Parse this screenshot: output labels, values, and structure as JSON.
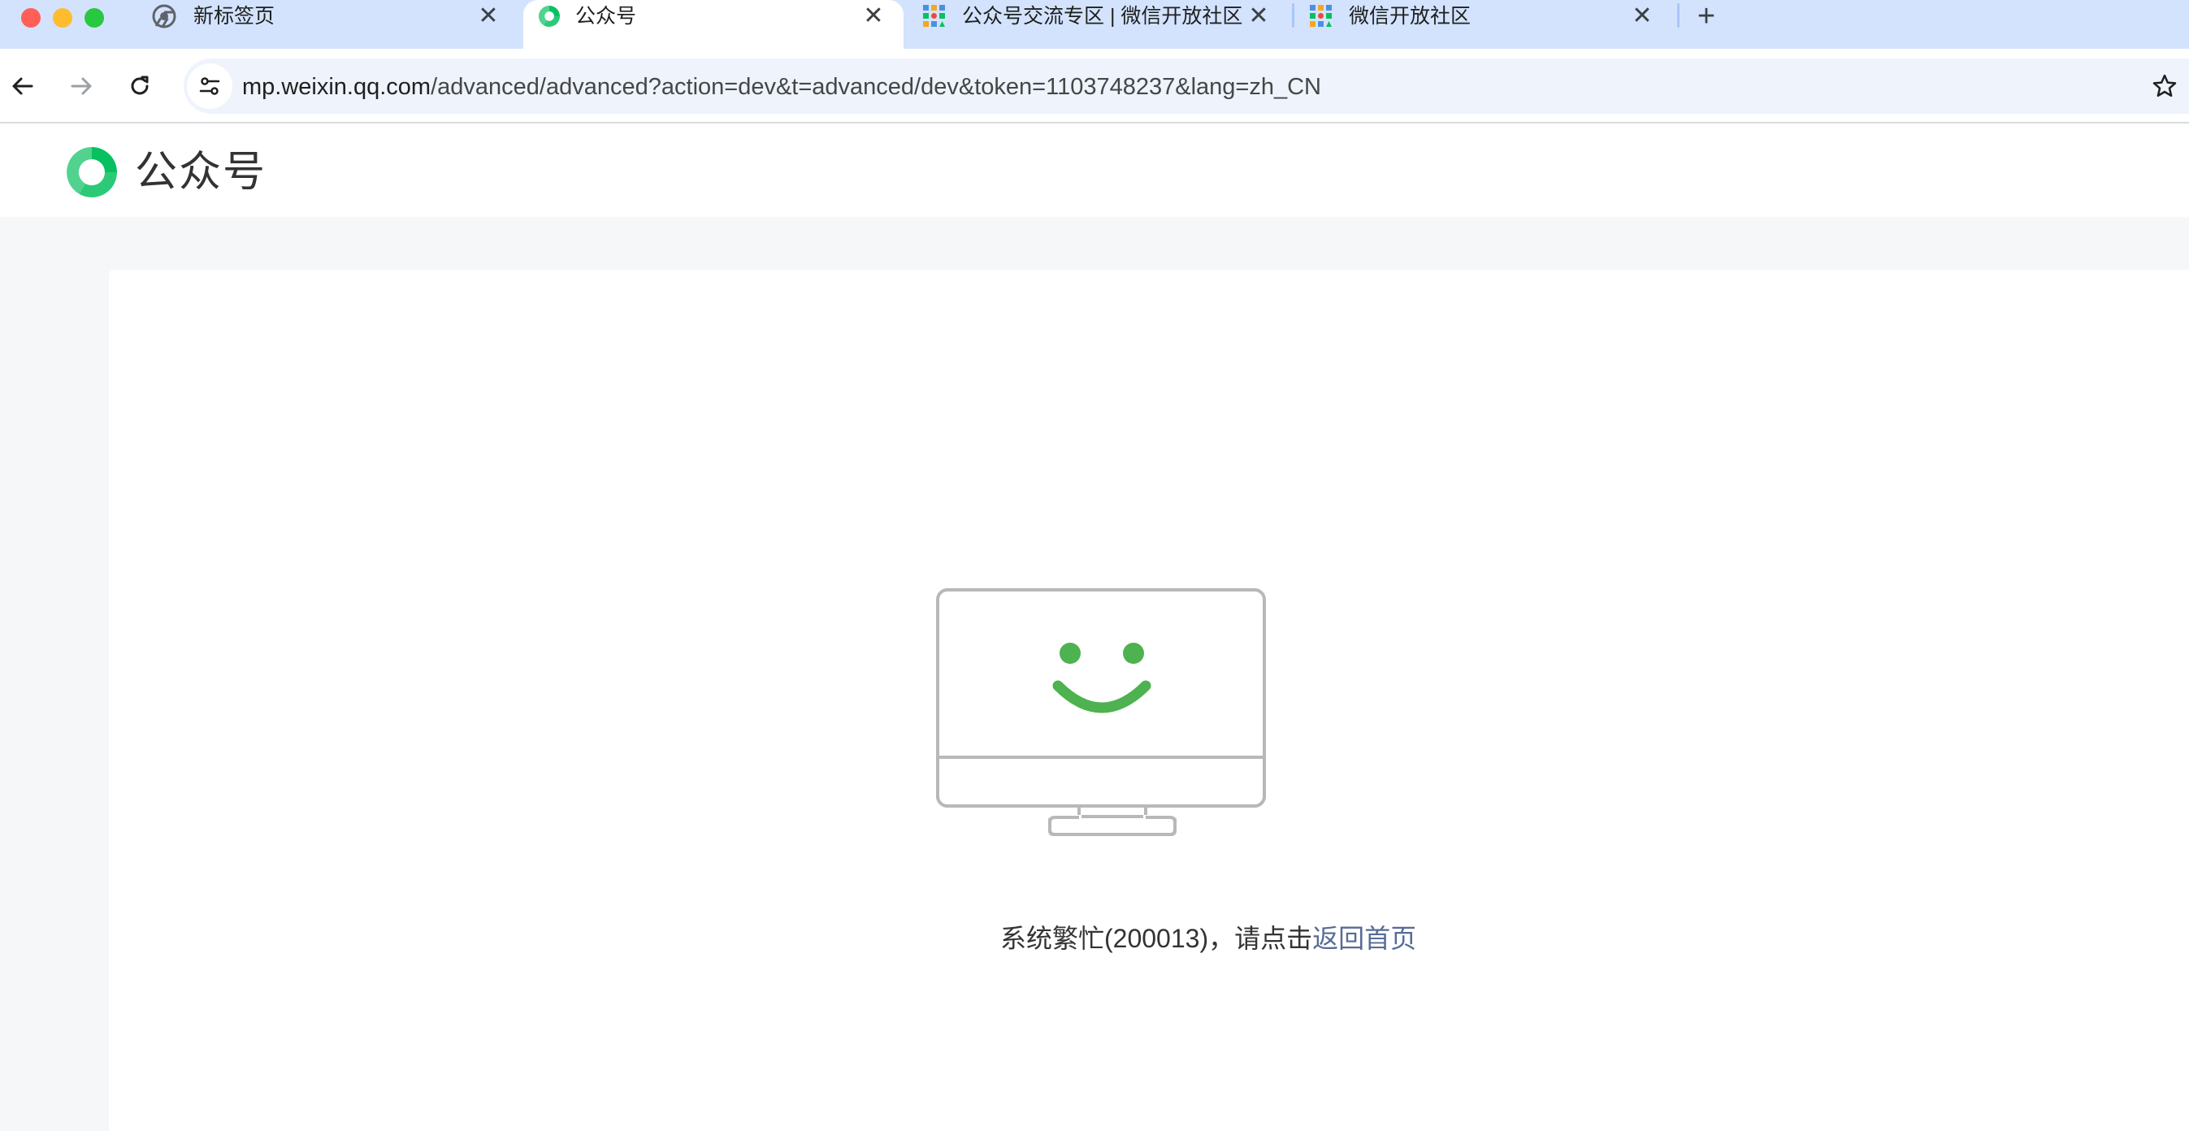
{
  "browser": {
    "tabs": [
      {
        "title": "新标签页",
        "icon": "chrome-icon",
        "active": false
      },
      {
        "title": "公众号",
        "icon": "wechat-mp-icon",
        "active": true
      },
      {
        "title": "公众号交流专区 | 微信开放社区",
        "icon": "wechat-community-icon",
        "active": false
      },
      {
        "title": "微信开放社区",
        "icon": "wechat-community-icon",
        "active": false
      }
    ],
    "close_glyph": "✕",
    "new_tab_glyph": "+",
    "url_host": "mp.weixin.qq.com",
    "url_path": "/advanced/advanced?action=dev&t=advanced/dev&token=1103748237&lang=zh_CN"
  },
  "header": {
    "logo_text": "公众号",
    "brand_color": "#07c160"
  },
  "error": {
    "message": "系统繁忙(200013)，请点击",
    "link_text": "返回首页",
    "illustration": "smiling-monitor",
    "accent_color": "#4db24f"
  }
}
